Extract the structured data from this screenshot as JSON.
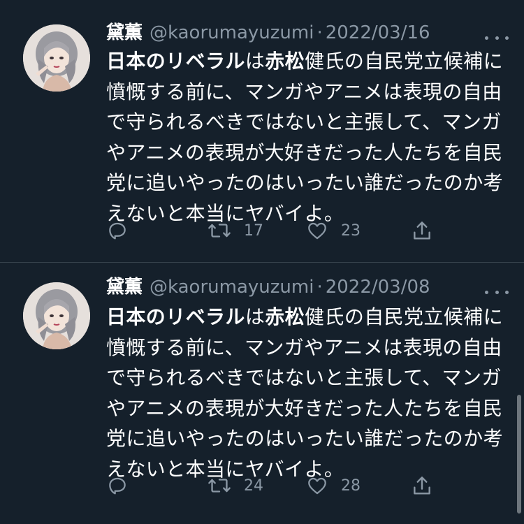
{
  "tweets": [
    {
      "display_name": "黛薫",
      "handle": "@kaorumayuzumi",
      "separator": "·",
      "date": "2022/03/16",
      "text_segments": [
        {
          "text": "日本の",
          "bold": true
        },
        {
          "text": "リベラル",
          "bold": true
        },
        {
          "text": "は",
          "bold": false
        },
        {
          "text": "赤松",
          "bold": true
        },
        {
          "text": "健氏の自民党立候補に憤慨する前に、マンガやアニメは表現の自由で守られるべきではないと主張して、マンガやアニメの表現が大好きだった人たちを自民党に追いやったのはいったい誰だったのか考えないと本当にヤバイよ。",
          "bold": false
        }
      ],
      "reply_count": "",
      "retweet_count": "17",
      "like_count": "23",
      "icons": [
        "reply-icon",
        "retweet-icon",
        "like-icon",
        "share-icon"
      ]
    },
    {
      "display_name": "黛薫",
      "handle": "@kaorumayuzumi",
      "separator": "·",
      "date": "2022/03/08",
      "text_segments": [
        {
          "text": "日本の",
          "bold": true
        },
        {
          "text": "リベラル",
          "bold": true
        },
        {
          "text": "は",
          "bold": false
        },
        {
          "text": "赤松",
          "bold": true
        },
        {
          "text": "健氏の自民党立候補に憤慨する前に、マンガやアニメは表現の自由で守られるべきではないと主張して、マンガやアニメの表現が大好きだった人たちを自民党に追いやったのはいったい誰だったのか考えないと本当にヤバイよ。",
          "bold": false
        }
      ],
      "reply_count": "",
      "retweet_count": "24",
      "like_count": "28",
      "icons": [
        "reply-icon",
        "retweet-icon",
        "like-icon",
        "share-icon"
      ]
    }
  ],
  "colors": {
    "background": "#15202b",
    "divider": "#38444d",
    "primary_text": "#ffffff",
    "secondary_text": "#8b98a5"
  }
}
